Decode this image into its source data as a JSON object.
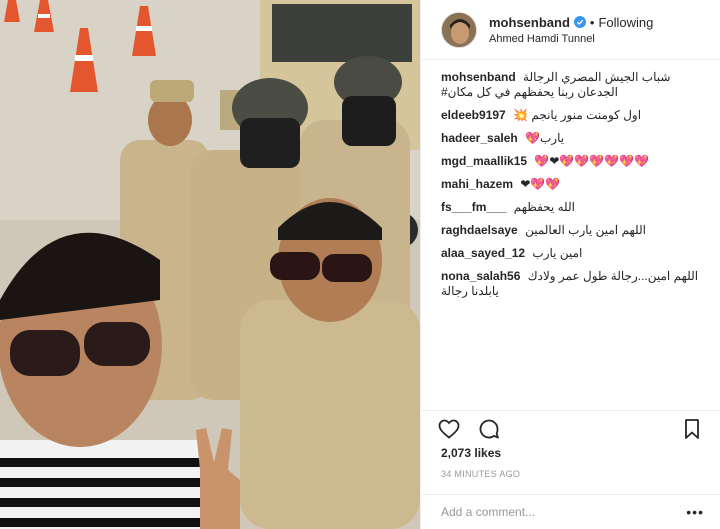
{
  "post": {
    "photo_description": "",
    "username": "mohsenband",
    "follow_status": "Following",
    "location": "Ahmed Hamdi Tunnel",
    "caption_user": "mohsenband",
    "caption_text": "شباب الجيش المصري الرجالة الجدعان ربنا يحفظهم في كل مكان#",
    "comments": [
      {
        "user": "eldeeb9197",
        "text": "اول كومنت منور يانجم 💥"
      },
      {
        "user": "hadeer_saleh",
        "text": "يارب💖"
      },
      {
        "user": "mgd_maallik15",
        "text": "💖❤💖💖💖💖💖💖"
      },
      {
        "user": "mahi_hazem",
        "text": "❤💖💖"
      },
      {
        "user": "fs___fm___",
        "text": "الله يحفظهم"
      },
      {
        "user": "raghdaelsaye",
        "text": "اللهم امين يارب العالمين"
      },
      {
        "user": "alaa_sayed_12",
        "text": "امين يارب"
      },
      {
        "user": "nona_salah56",
        "text": "اللهم امين...رجالة طول عمر ولادك يابلدنا رجالة"
      }
    ],
    "likes": "2,073 likes",
    "time_ago": "34 MINUTES AGO",
    "add_comment_placeholder": "Add a comment...",
    "more_label": "•••",
    "verified_color": "#3897f0"
  }
}
